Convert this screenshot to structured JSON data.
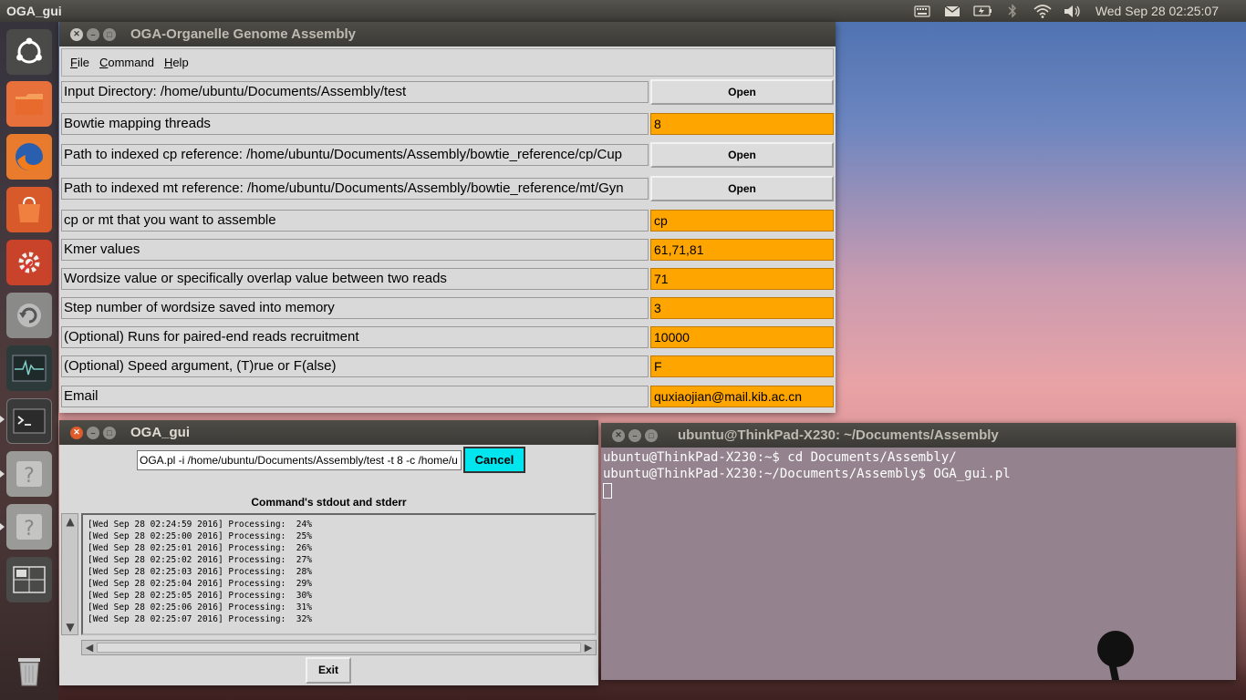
{
  "top_panel": {
    "app_title": "OGA_gui",
    "clock": "Wed Sep 28 02:25:07",
    "indicators": [
      "keyboard-icon",
      "mail-icon",
      "battery-icon",
      "bluetooth-icon",
      "wifi-icon",
      "volume-icon"
    ]
  },
  "launcher": {
    "items": [
      "ubuntu-dash",
      "files",
      "firefox",
      "software-center",
      "system-settings",
      "backup",
      "system-monitor",
      "terminal",
      "help",
      "help",
      "workspace-switcher",
      "trash"
    ]
  },
  "main_window": {
    "title": "OGA-Organelle Genome Assembly",
    "menu": [
      "File",
      "Command",
      "Help"
    ],
    "rows": [
      {
        "label": "Input Directory: /home/ubuntu/Documents/Assembly/test",
        "button": "Open"
      },
      {
        "label": "Bowtie mapping threads",
        "value": "8"
      },
      {
        "label": "Path to indexed cp reference: /home/ubuntu/Documents/Assembly/bowtie_reference/cp/Cup",
        "button": "Open"
      },
      {
        "label": "Path to indexed mt reference: /home/ubuntu/Documents/Assembly/bowtie_reference/mt/Gyn",
        "button": "Open"
      },
      {
        "label": "cp or mt that you want to assemble",
        "value": "cp"
      },
      {
        "label": "Kmer values",
        "value": "61,71,81"
      },
      {
        "label": "Wordsize value or specifically overlap value between two reads",
        "value": "71"
      },
      {
        "label": "Step number of wordsize saved into memory",
        "value": "3"
      },
      {
        "label": "(Optional) Runs for paired-end reads recruitment",
        "value": "10000"
      },
      {
        "label": "(Optional) Speed argument, (T)rue or F(alse)",
        "value": "F"
      },
      {
        "label": "Email",
        "value": "quxiaojian@mail.kib.ac.cn"
      }
    ]
  },
  "gui_window": {
    "title": "OGA_gui",
    "command": "OGA.pl -i /home/ubuntu/Documents/Assembly/test -t 8 -c /home/u",
    "cancel_label": "Cancel",
    "output_title": "Command's stdout and stderr",
    "output_lines": [
      "[Wed Sep 28 02:24:59 2016] Processing:  24%",
      "[Wed Sep 28 02:25:00 2016] Processing:  25%",
      "[Wed Sep 28 02:25:01 2016] Processing:  26%",
      "[Wed Sep 28 02:25:02 2016] Processing:  27%",
      "[Wed Sep 28 02:25:03 2016] Processing:  28%",
      "[Wed Sep 28 02:25:04 2016] Processing:  29%",
      "[Wed Sep 28 02:25:05 2016] Processing:  30%",
      "[Wed Sep 28 02:25:06 2016] Processing:  31%",
      "[Wed Sep 28 02:25:07 2016] Processing:  32%"
    ],
    "exit_label": "Exit"
  },
  "terminal": {
    "title": "ubuntu@ThinkPad-X230: ~/Documents/Assembly",
    "lines": [
      "ubuntu@ThinkPad-X230:~$ cd Documents/Assembly/",
      "ubuntu@ThinkPad-X230:~/Documents/Assembly$ OGA_gui.pl"
    ]
  },
  "colors": {
    "field_bg": "#ffa500",
    "cancel_bg": "#00e5ee",
    "terminal_bg": "#94838e"
  }
}
